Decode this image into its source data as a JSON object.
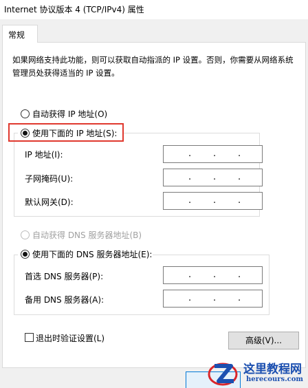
{
  "window": {
    "title": "Internet 协议版本 4 (TCP/IPv4) 属性"
  },
  "tabs": [
    {
      "label": "常规"
    }
  ],
  "description": "如果网络支持此功能，则可以获取自动指派的 IP 设置。否则，你需要从网络系统管理员处获得适当的 IP 设置。",
  "ip_section": {
    "auto_option_label": "自动获得 IP 地址(O)",
    "auto_selected": false,
    "manual_option_label": "使用下面的 IP 地址(S):",
    "manual_selected": true,
    "fields": [
      {
        "label": "IP 地址(I):",
        "value": ". . ."
      },
      {
        "label": "子网掩码(U):",
        "value": ". . ."
      },
      {
        "label": "默认网关(D):",
        "value": ". . ."
      }
    ]
  },
  "dns_section": {
    "auto_option_label": "自动获得 DNS 服务器地址(B)",
    "auto_selected": false,
    "auto_disabled": true,
    "manual_option_label": "使用下面的 DNS 服务器地址(E):",
    "manual_selected": true,
    "fields": [
      {
        "label": "首选 DNS 服务器(P):",
        "value": ". . ."
      },
      {
        "label": "备用 DNS 服务器(A):",
        "value": ". . ."
      }
    ]
  },
  "validate_on_exit": {
    "label": "退出时验证设置(L)",
    "checked": false
  },
  "buttons": {
    "advanced_label": "高级(V)..."
  },
  "watermark": {
    "title": "这里教程网",
    "url": "herecours.com"
  },
  "colors": {
    "highlight_box": "#e0382e",
    "watermark_blue": "#1b4fb0",
    "watermark_red": "#d9262b"
  }
}
